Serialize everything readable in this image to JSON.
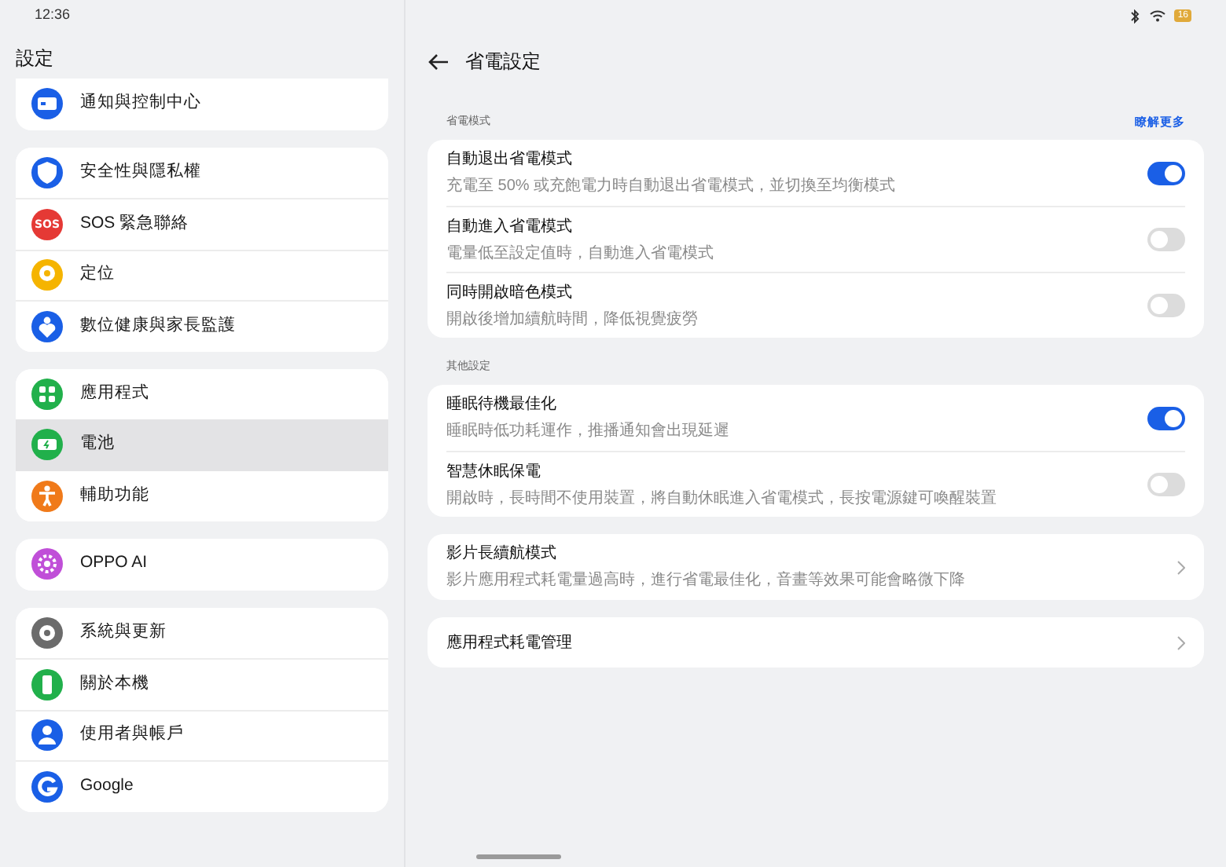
{
  "status_bar": {
    "time": "12:36",
    "battery": "16"
  },
  "sidebar": {
    "title": "設定",
    "groups": [
      {
        "items": [
          {
            "label": "通知與控制中心",
            "color": "#1a5fe6",
            "selected": false
          }
        ]
      },
      {
        "items": [
          {
            "label": "安全性與隱私權",
            "color": "#1a5fe6",
            "selected": false
          },
          {
            "label": "SOS 緊急聯絡",
            "color": "#e53935",
            "icon_text": "SOS",
            "selected": false
          },
          {
            "label": "定位",
            "color": "#f5b400",
            "selected": false
          },
          {
            "label": "數位健康與家長監護",
            "color": "#1a5fe6",
            "selected": false
          }
        ]
      },
      {
        "items": [
          {
            "label": "應用程式",
            "color": "#21b04b",
            "selected": false
          },
          {
            "label": "電池",
            "color": "#21b04b",
            "selected": true
          },
          {
            "label": "輔助功能",
            "color": "#f07a1a",
            "selected": false
          }
        ]
      },
      {
        "items": [
          {
            "label": "OPPO AI",
            "color": "#c04fd8",
            "selected": false
          }
        ]
      },
      {
        "items": [
          {
            "label": "系統與更新",
            "color": "#6b6b6b",
            "selected": false
          },
          {
            "label": "關於本機",
            "color": "#21b04b",
            "selected": false
          },
          {
            "label": "使用者與帳戶",
            "color": "#1a5fe6",
            "selected": false
          },
          {
            "label": "Google",
            "color": "#1a5fe6",
            "selected": false
          }
        ]
      }
    ]
  },
  "page": {
    "title": "省電設定",
    "sections": [
      {
        "label": "省電模式",
        "link": "瞭解更多",
        "rows": [
          {
            "kind": "toggle",
            "title": "自動退出省電模式",
            "subtitle": "充電至 50% 或充飽電力時自動退出省電模式，並切換至均衡模式",
            "on": true
          },
          {
            "kind": "toggle",
            "title": "自動進入省電模式",
            "subtitle": "電量低至設定值時，自動進入省電模式",
            "on": false
          },
          {
            "kind": "toggle",
            "title": "同時開啟暗色模式",
            "subtitle": "開啟後增加續航時間，降低視覺疲勞",
            "on": false
          }
        ]
      },
      {
        "label": "其他設定",
        "rows": [
          {
            "kind": "toggle",
            "title": "睡眠待機最佳化",
            "subtitle": "睡眠時低功耗運作，推播通知會出現延遲",
            "on": true
          },
          {
            "kind": "toggle",
            "title": "智慧休眠保電",
            "subtitle": "開啟時，長時間不使用裝置，將自動休眠進入省電模式，長按電源鍵可喚醒裝置",
            "on": false
          }
        ]
      },
      {
        "rows": [
          {
            "kind": "link",
            "title": "影片長續航模式",
            "subtitle": "影片應用程式耗電量過高時，進行省電最佳化，音畫等效果可能會略微下降"
          }
        ]
      },
      {
        "rows": [
          {
            "kind": "link",
            "title": "應用程式耗電管理"
          }
        ]
      }
    ]
  }
}
